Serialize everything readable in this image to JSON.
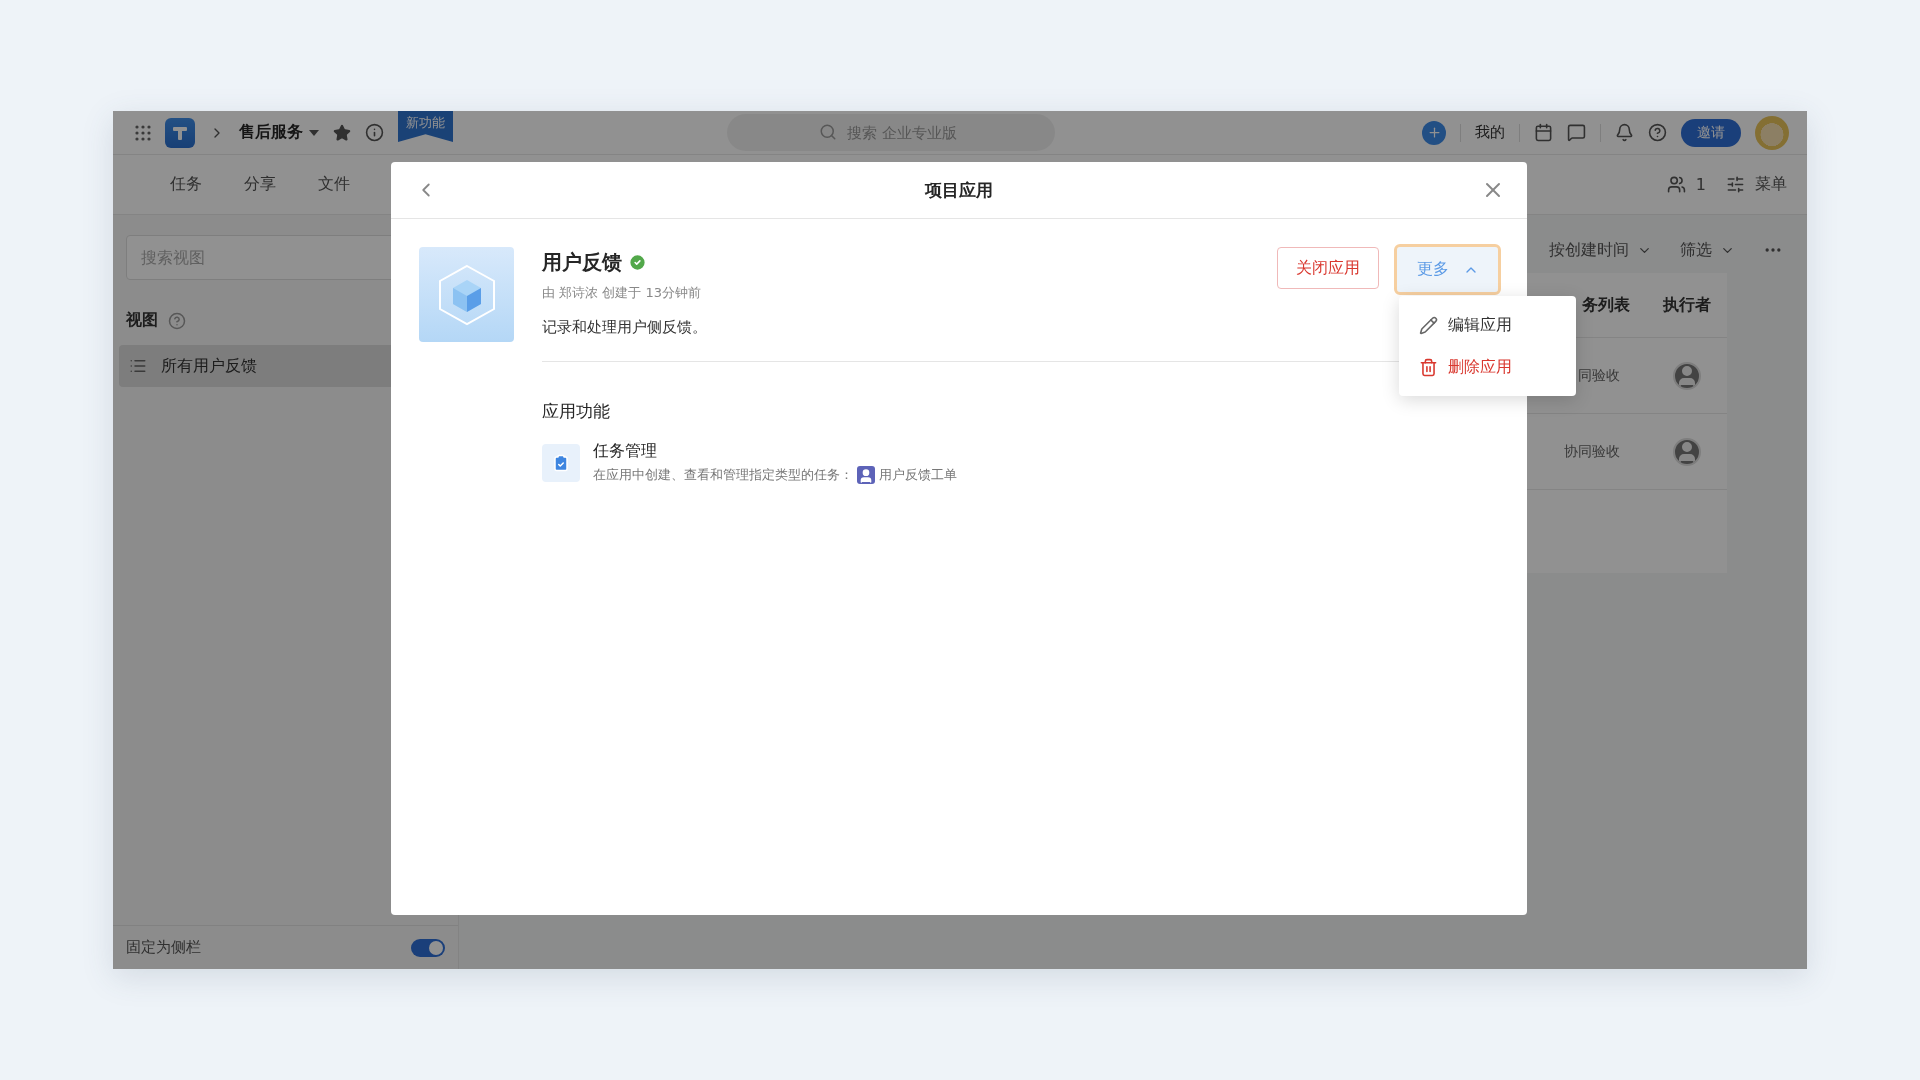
{
  "topbar": {
    "project": "售后服务",
    "new_badge": "新功能",
    "search_placeholder": "搜索 企业专业版",
    "mine": "我的",
    "invite": "邀请"
  },
  "nav_tabs": [
    {
      "label": "任务"
    },
    {
      "label": "分享"
    },
    {
      "label": "文件"
    }
  ],
  "members": {
    "count": "1"
  },
  "menu": "菜单",
  "sidebar": {
    "search_placeholder": "搜索视图",
    "section": "视图",
    "items": [
      {
        "label": "所有用户反馈",
        "selected": true
      }
    ],
    "pin": {
      "label": "固定为侧栏",
      "on": true
    }
  },
  "toolbar": {
    "sort": "按创建时间",
    "filter": "筛选"
  },
  "table": {
    "columns": [
      "务列表",
      "执行者"
    ],
    "rows": [
      {
        "cells": [
          "同验收"
        ]
      },
      {
        "cells": [
          "协同验收"
        ]
      }
    ]
  },
  "dialog": {
    "title": "项目应用",
    "app": {
      "name": "用户反馈",
      "verified": true,
      "meta": "由 郑诗浓 创建于 13分钟前",
      "description": "记录和处理用户侧反馈。"
    },
    "close_app": "关闭应用",
    "more": {
      "label": "更多",
      "expanded": true,
      "items": [
        {
          "label": "编辑应用",
          "kind": "edit"
        },
        {
          "label": "删除应用",
          "kind": "danger"
        }
      ]
    },
    "features_title": "应用功能",
    "features": [
      {
        "name": "任务管理",
        "description": "在应用中创建、查看和管理指定类型的任务：",
        "type_tag": "用户反馈工单"
      }
    ]
  }
}
